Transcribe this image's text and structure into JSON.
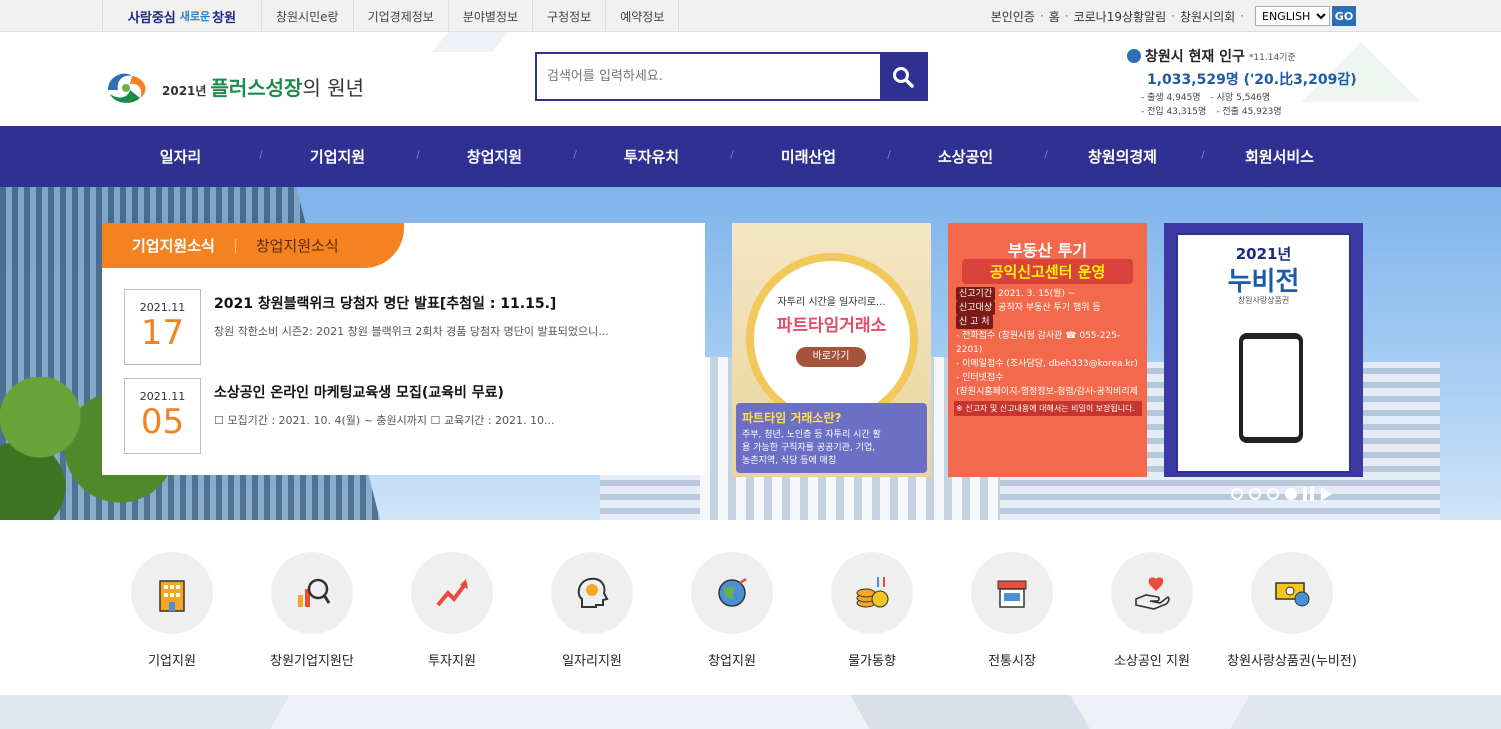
{
  "topbar": {
    "slogan": [
      "사람중심",
      "새로운",
      "창원"
    ],
    "links": [
      "창원시민e랑",
      "기업경제정보",
      "분야별정보",
      "구청정보",
      "예약정보"
    ],
    "right_links": [
      "본인인증",
      "홈",
      "코로나19상황알림",
      "창원시의회"
    ],
    "language": "ENGLISH",
    "go_label": "GO"
  },
  "header": {
    "logo_year": "2021년",
    "logo_main": "플러스성장",
    "logo_tail": "의 원년",
    "search_placeholder": "검색어를 입력하세요.",
    "population": {
      "title": "창원시 현재 인구",
      "date": "*11.14기준",
      "count": "1,033,529명 ('20.比3,209감)",
      "births": "- 출생 4,945명",
      "deaths": "- 사망 5,546명",
      "move_in": "- 전입 43,315명",
      "move_out": "- 전출 45,923명"
    }
  },
  "nav": [
    "일자리",
    "기업지원",
    "창업지원",
    "투자유치",
    "미래산업",
    "소상공인",
    "창원의경제",
    "회원서비스"
  ],
  "news": {
    "tabs": [
      "기업지원소식",
      "창업지원소식"
    ],
    "items": [
      {
        "ym": "2021.11",
        "day": "17",
        "title": "2021 창원블랙위크 당첨자 명단 발표[추첨일 : 11.15.]",
        "desc": "창원 착한소비 시즌2: 2021 창원 블랙위크 2회차 경품 당첨자 명단이 발표되었으니..."
      },
      {
        "ym": "2021.11",
        "day": "05",
        "title": "소상공인 온라인 마케팅교육생 모집(교육비 무료)",
        "desc": "☐ 모집기간 : 2021. 10. 4(월) ~ 충원시까지 ☐ 교육기간 : 2021. 10..."
      }
    ]
  },
  "cards": {
    "card1": {
      "t1": "자투리 시간을 일자리로...",
      "t2": "파트타임거래소",
      "btn": "바로가기",
      "box_title": "파트타임 거래소란?",
      "box_body": "주부, 청년, 노인층 등 자투리 시간 활용 가능한 구직자를 공공기관, 기업, 농촌지역, 식당 등에 매칭"
    },
    "card2": {
      "h1": "부동산 투기",
      "h2": "공익신고센터 운영",
      "l1_tag": "신고기간",
      "l1": "2021. 3. 15(월) ~",
      "l2_tag": "신고대상",
      "l2": "공직자 부동산 투기 행위 등",
      "l3_tag": "신 고 처",
      "l4": "- 전화접수 (창원시청 감사관 ☎ 055-225-2201)",
      "l5": "- 이메일접수 (조사담당, dbeh333@korea.kr)",
      "l6": "- 인터넷접수",
      "l7": "(창원시홈페이지-행정정보-청렴/감사-공직비리제보)",
      "note": "※ 신고자 및 신고내용에 대해서는 비밀이 보장됩니다."
    },
    "card3": {
      "year": "2021년",
      "title": "누비전",
      "sub": "창원사랑상품권"
    }
  },
  "quick": [
    "기업지원",
    "창원기업지원단",
    "투자지원",
    "일자리지원",
    "창업지원",
    "물가동향",
    "전통시장",
    "소상공인 지원",
    "창원사랑상품권(누비전)"
  ],
  "colors": {
    "nav_bg": "#2e3192",
    "accent_orange": "#f58220",
    "population_blue": "#1e5aa8"
  }
}
